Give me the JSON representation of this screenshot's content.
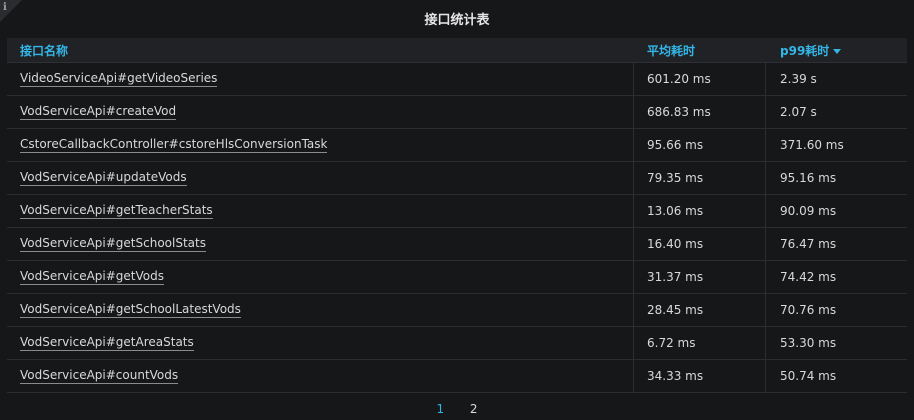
{
  "panel": {
    "title": "接口统计表"
  },
  "table": {
    "headers": [
      "接口名称",
      "平均耗时",
      "p99耗时"
    ],
    "rows": [
      {
        "name": "VideoServiceApi#getVideoSeries",
        "avg": "601.20 ms",
        "p99": "2.39 s"
      },
      {
        "name": "VodServiceApi#createVod",
        "avg": "686.83 ms",
        "p99": "2.07 s"
      },
      {
        "name": "CstoreCallbackController#cstoreHlsConversionTask",
        "avg": "95.66 ms",
        "p99": "371.60 ms"
      },
      {
        "name": "VodServiceApi#updateVods",
        "avg": "79.35 ms",
        "p99": "95.16 ms"
      },
      {
        "name": "VodServiceApi#getTeacherStats",
        "avg": "13.06 ms",
        "p99": "90.09 ms"
      },
      {
        "name": "VodServiceApi#getSchoolStats",
        "avg": "16.40 ms",
        "p99": "76.47 ms"
      },
      {
        "name": "VodServiceApi#getVods",
        "avg": "31.37 ms",
        "p99": "74.42 ms"
      },
      {
        "name": "VodServiceApi#getSchoolLatestVods",
        "avg": "28.45 ms",
        "p99": "70.76 ms"
      },
      {
        "name": "VodServiceApi#getAreaStats",
        "avg": "6.72 ms",
        "p99": "53.30 ms"
      },
      {
        "name": "VodServiceApi#countVods",
        "avg": "34.33 ms",
        "p99": "50.74 ms"
      }
    ]
  },
  "pagination": {
    "pages": [
      "1",
      "2"
    ],
    "current": "1"
  },
  "colors": {
    "accent": "#33b5e5",
    "background": "#161719",
    "header_bg": "#202226"
  }
}
